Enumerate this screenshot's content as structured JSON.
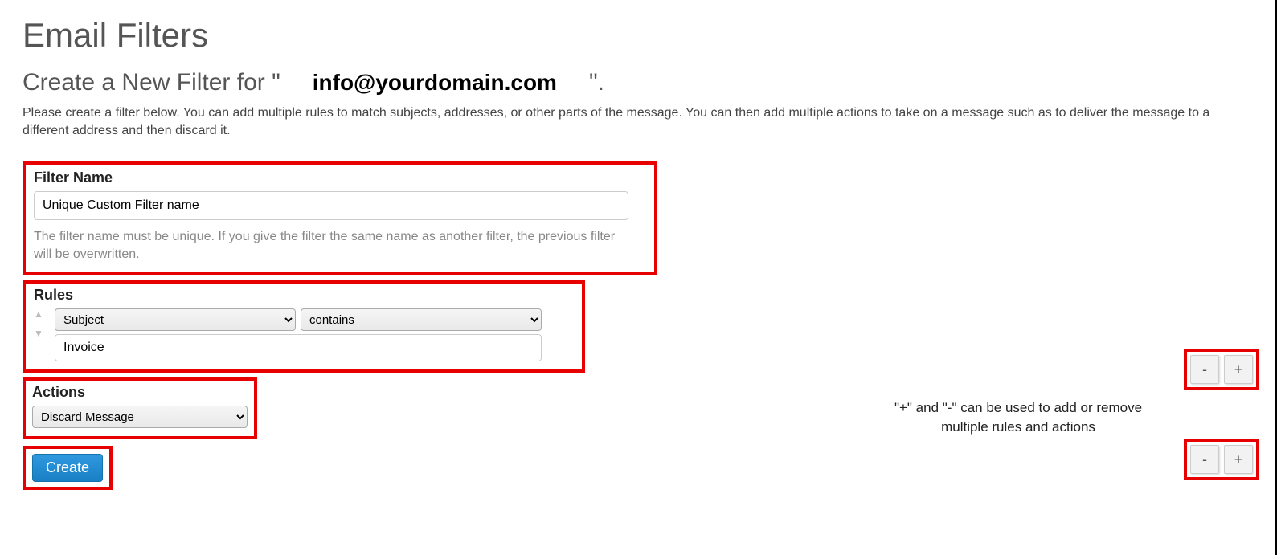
{
  "page": {
    "title": "Email Filters",
    "subtitle_prefix": "Create a New Filter for \"",
    "email": "info@yourdomain.com",
    "subtitle_suffix": "\".",
    "description": "Please create a filter below. You can add multiple rules to match subjects, addresses, or other parts of the message. You can then add multiple actions to take on a message such as to deliver the message to a different address and then discard it."
  },
  "filter_name": {
    "label": "Filter Name",
    "value": "Unique Custom Filter name",
    "help": "The filter name must be unique. If you give the filter the same name as another filter, the previous filter will be overwritten."
  },
  "rules": {
    "label": "Rules",
    "field_value": "Subject",
    "operator_value": "contains",
    "match_value": "Invoice"
  },
  "actions": {
    "label": "Actions",
    "value": "Discard Message"
  },
  "buttons": {
    "create": "Create",
    "minus": "-",
    "plus": "+"
  },
  "side_hint": "\"+\" and \"-\" can be used to add or remove multiple rules and actions"
}
